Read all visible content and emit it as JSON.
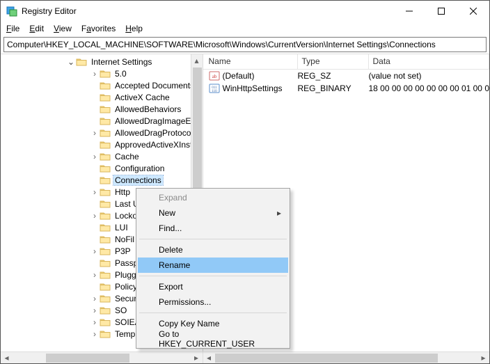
{
  "window": {
    "title": "Registry Editor"
  },
  "menu": {
    "file": "File",
    "edit": "Edit",
    "view": "View",
    "favorites": "Favorites",
    "help": "Help"
  },
  "address": "Computer\\HKEY_LOCAL_MACHINE\\SOFTWARE\\Microsoft\\Windows\\CurrentVersion\\Internet Settings\\Connections",
  "tree": {
    "root": "Internet Settings",
    "items": [
      {
        "label": "5.0",
        "exp": true
      },
      {
        "label": "Accepted Documents",
        "exp": false
      },
      {
        "label": "ActiveX Cache",
        "exp": false
      },
      {
        "label": "AllowedBehaviors",
        "exp": false
      },
      {
        "label": "AllowedDragImageExts",
        "exp": false
      },
      {
        "label": "AllowedDragProtocols",
        "exp": true
      },
      {
        "label": "ApprovedActiveXInstal",
        "exp": false
      },
      {
        "label": "Cache",
        "exp": true
      },
      {
        "label": "Configuration",
        "exp": false
      },
      {
        "label": "Connections",
        "exp": false,
        "sel": true
      },
      {
        "label": "Http ",
        "exp": true
      },
      {
        "label": "Last U",
        "exp": false
      },
      {
        "label": "Locko",
        "exp": true
      },
      {
        "label": "LUI",
        "exp": false
      },
      {
        "label": "NoFil",
        "exp": false
      },
      {
        "label": "P3P",
        "exp": true
      },
      {
        "label": "Passp",
        "exp": false
      },
      {
        "label": "Plugg",
        "exp": true
      },
      {
        "label": "Policy",
        "exp": false
      },
      {
        "label": "Secur",
        "exp": true
      },
      {
        "label": "SO",
        "exp": true
      },
      {
        "label": "SOIEA",
        "exp": true
      },
      {
        "label": "TemplatePolicies",
        "exp": true
      }
    ]
  },
  "list": {
    "cols": {
      "name": "Name",
      "type": "Type",
      "data": "Data"
    },
    "rows": [
      {
        "icon": "sz",
        "name": "(Default)",
        "type": "REG_SZ",
        "data": "(value not set)"
      },
      {
        "icon": "bin",
        "name": "WinHttpSettings",
        "type": "REG_BINARY",
        "data": "18 00 00 00 00 00 00 00 01 00 0"
      }
    ]
  },
  "ctx": {
    "expand": "Expand",
    "new": "New",
    "find": "Find...",
    "delete": "Delete",
    "rename": "Rename",
    "export": "Export",
    "permissions": "Permissions...",
    "copy": "Copy Key Name",
    "goto": "Go to HKEY_CURRENT_USER"
  }
}
